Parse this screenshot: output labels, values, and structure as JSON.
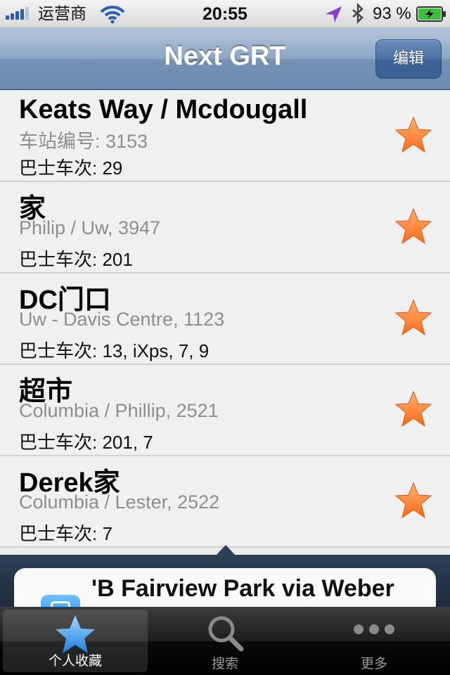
{
  "status_bar": {
    "carrier": "运营商",
    "time": "20:55",
    "battery": "93 %"
  },
  "nav": {
    "title": "Next GRT",
    "edit_label": "编辑"
  },
  "favorites": [
    {
      "name": "Keats Way / Mcdougall",
      "stop": "车站编号: 3153",
      "routes": "巴士车次: 29"
    },
    {
      "name": "家",
      "stop": "Philip / Uw, 3947",
      "routes": "巴士车次: 201"
    },
    {
      "name": "DC门口",
      "stop": "Uw - Davis Centre, 1123",
      "routes": "巴士车次: 13, iXps, 7, 9"
    },
    {
      "name": "超市",
      "stop": "Columbia / Phillip, 2521",
      "routes": "巴士车次: 201, 7"
    },
    {
      "name": "Derek家",
      "stop": "Columbia / Lester, 2522",
      "routes": "巴士车次: 7"
    }
  ],
  "popup": {
    "text": "'B Fairview Park via Weber"
  },
  "tabs": [
    {
      "label": "个人收藏",
      "icon": "star-icon",
      "active": true
    },
    {
      "label": "搜索",
      "icon": "search-icon",
      "active": false
    },
    {
      "label": "更多",
      "icon": "more-icon",
      "active": false
    }
  ],
  "colors": {
    "star": "#ff8a3d",
    "nav": "#7692b5"
  }
}
